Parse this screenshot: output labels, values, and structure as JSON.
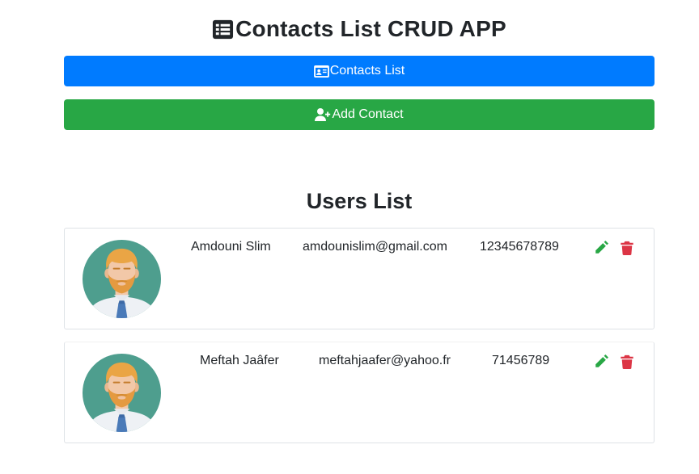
{
  "app": {
    "title": "Contacts List CRUD APP",
    "title_icon": "list-alt-icon"
  },
  "nav": {
    "contacts_list_label": "Contacts List",
    "contacts_list_icon": "address-card-icon",
    "add_contact_label": "Add Contact",
    "add_contact_icon": "user-plus-icon"
  },
  "users_section": {
    "title": "Users List",
    "contacts": [
      {
        "name": "Amdouni Slim",
        "email": "amdounislim@gmail.com",
        "phone": "12345678789"
      },
      {
        "name": "Meftah Jaâfer",
        "email": "meftahjaafer@yahoo.fr",
        "phone": "71456789"
      }
    ],
    "actions": {
      "edit_icon": "pencil-icon",
      "delete_icon": "trash-icon"
    }
  },
  "colors": {
    "primary": "#007bff",
    "success": "#28a745",
    "danger": "#dc3545",
    "avatar_bg": "#4e9e8e"
  }
}
